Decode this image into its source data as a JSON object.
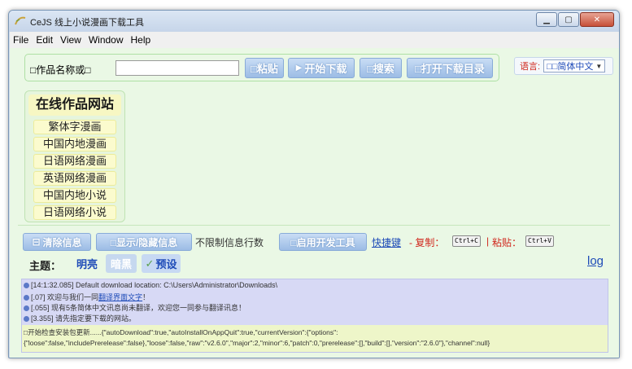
{
  "window": {
    "title": "CeJS 线上小说漫画下载工具",
    "icon": "app-icon",
    "controls": [
      "minimize-icon",
      "maximize-icon",
      "close-icon"
    ]
  },
  "menubar": {
    "items": [
      "File",
      "Edit",
      "View",
      "Window",
      "Help"
    ]
  },
  "search": {
    "label": "□作品名称或□",
    "input_value": "",
    "paste_button": "□粘贴",
    "start_button": "开始下载",
    "search_button": "□搜索",
    "open_dir_button": "□打开下载目录"
  },
  "language": {
    "label": "语言:",
    "selected": "□□简体中文"
  },
  "sites": {
    "title": "在线作品网站",
    "items": [
      "繁体字漫画",
      "中国内地漫画",
      "日语网络漫画",
      "英语网络漫画",
      "中国内地小说",
      "日语网络小说"
    ]
  },
  "toolbar": {
    "clear_button": "清除信息",
    "toggle_info_button": "□显示/隐藏信息",
    "unlimited_text": "不限制信息行数",
    "dev_tools_button": "□启用开发工具",
    "shortcut_link": "快捷键",
    "copy_label": "- 复制：",
    "copy_key": "Ctrl+C",
    "separator": "|",
    "paste_label": "粘贴：",
    "paste_key": "Ctrl+V"
  },
  "theme": {
    "label": "主题：",
    "options": [
      "明亮",
      "暗黑",
      "预设"
    ],
    "checked_mark": "✓"
  },
  "log_link": "log",
  "log": {
    "lines": [
      {
        "time": "[14:1:32.085]",
        "text": " Default download location: C:\\Users\\Administrator\\Downloads\\",
        "link": ""
      },
      {
        "time": "[.07]",
        "text": " 欢迎与我们一同",
        "link": "翻译界面文字",
        "suffix": "！"
      },
      {
        "time": "[.055]",
        "text": " 现有5条简体中文讯息尚未翻译，欢迎您一同参与翻译讯息！",
        "link": ""
      },
      {
        "time": "[3.355]",
        "text": " 请先指定要下载的网站。",
        "link": ""
      }
    ],
    "json_line_1": "□开始检查安装包更新......{\"autoDownload\":true,\"autoInstallOnAppQuit\":true,\"currentVersion\":{\"options\":",
    "json_line_2": "{\"loose\":false,\"includePrerelease\":false},\"loose\":false,\"raw\":\"v2.6.0\",\"major\":2,\"minor\":6,\"patch\":0,\"prerelease\":[],\"build\":[],\"version\":\"2.6.0\"},\"channel\":null}"
  },
  "colors": {
    "client_bg": "#eaf8e5",
    "button_blue": "#9cbce5",
    "accent_red": "#d0271d",
    "link_blue": "#1e4bb8",
    "log_bg": "#d7d9f5"
  }
}
